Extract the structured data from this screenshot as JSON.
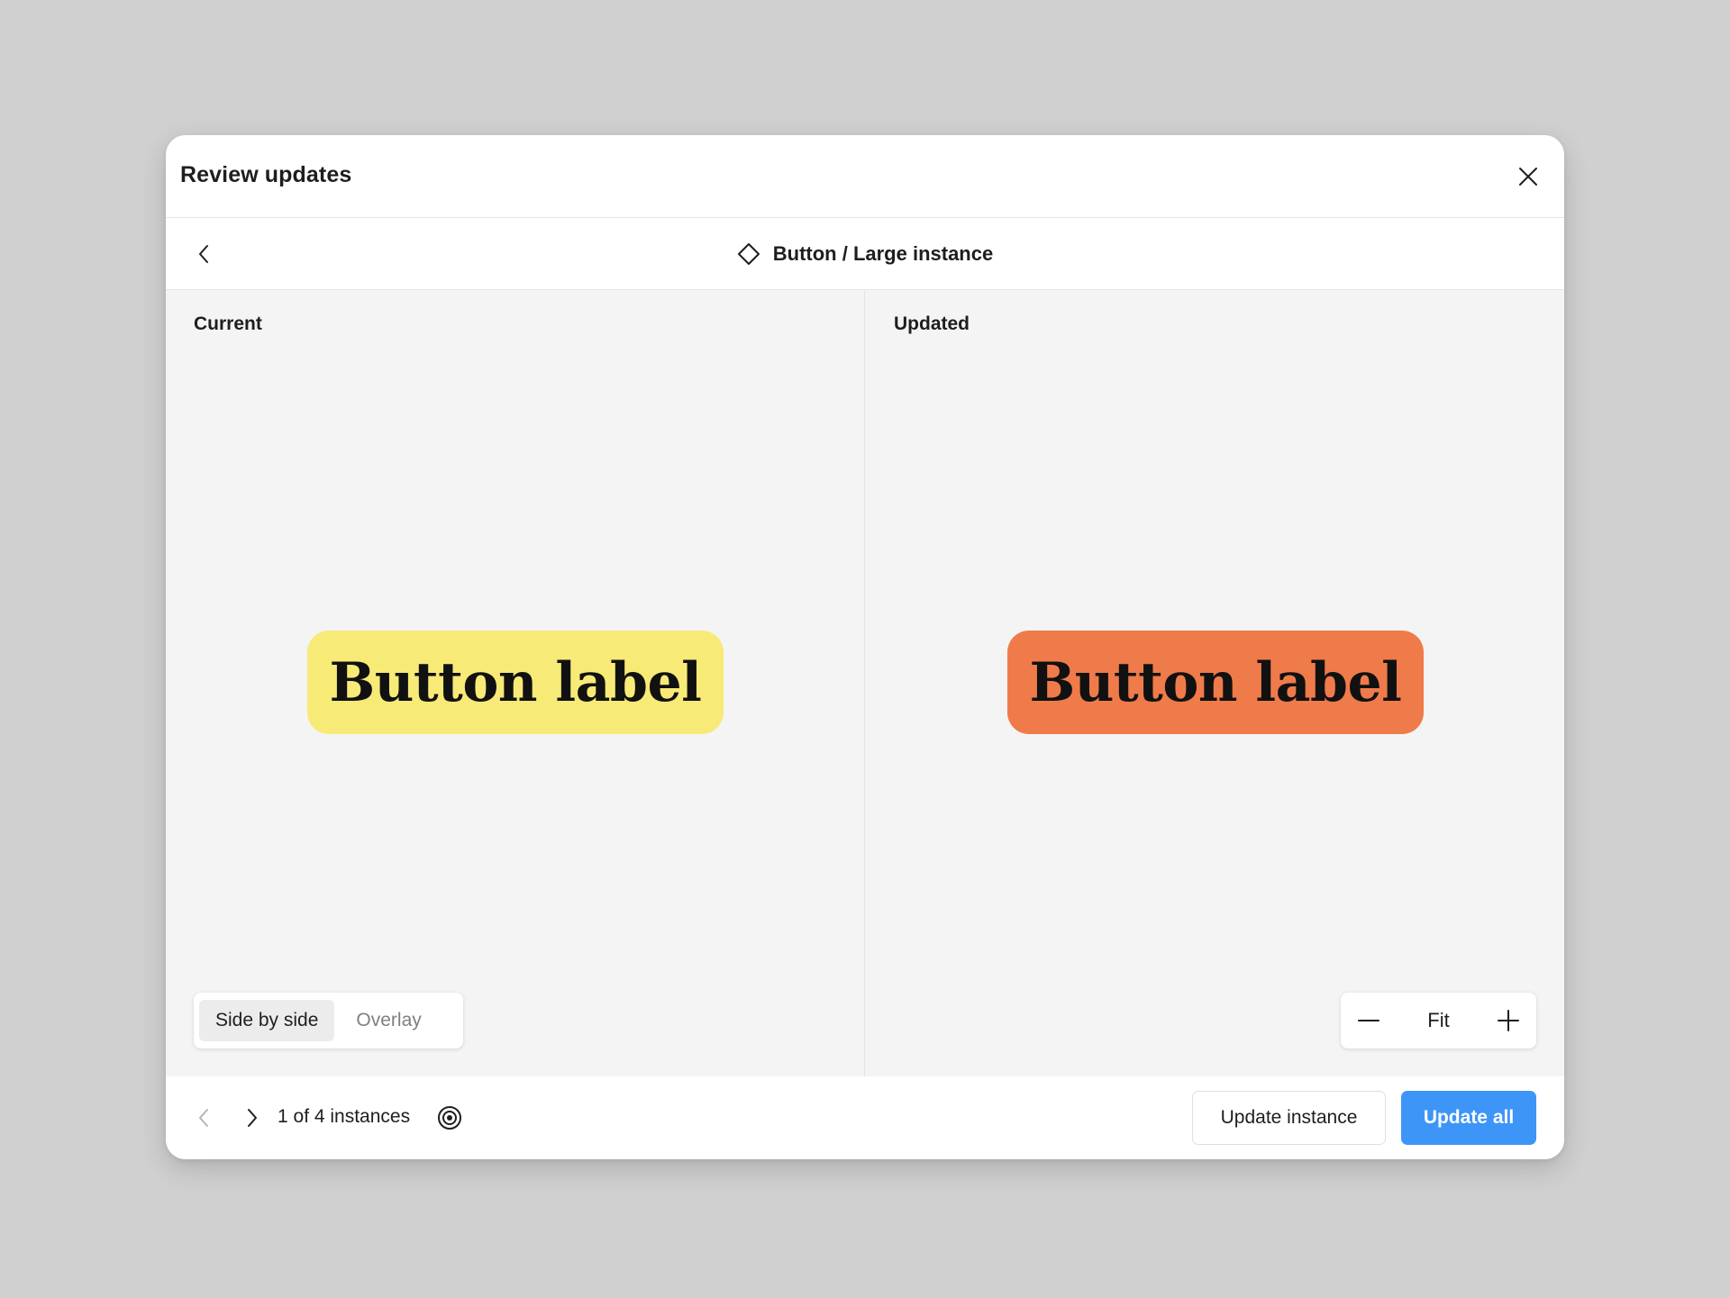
{
  "modal": {
    "title": "Review updates"
  },
  "subheader": {
    "component_name": "Button / Large instance",
    "component_icon": "component-diamond-icon"
  },
  "compare": {
    "current": {
      "label": "Current",
      "preview_text": "Button label",
      "preview_color": "#f8ea77"
    },
    "updated": {
      "label": "Updated",
      "preview_text": "Button label",
      "preview_color": "#ef7b4a"
    }
  },
  "view_toggle": {
    "options": [
      "Side by side",
      "Overlay"
    ],
    "selected": "Side by side"
  },
  "zoom": {
    "level": "Fit",
    "decrease_icon": "minus-icon",
    "increase_icon": "plus-icon"
  },
  "footer": {
    "instance_count": "1 of 4 instances",
    "update_instance_label": "Update instance",
    "update_all_label": "Update all"
  },
  "colors": {
    "backdrop": "#d0d0d0",
    "canvas": "#f4f4f4",
    "primary": "#3d95f7"
  }
}
